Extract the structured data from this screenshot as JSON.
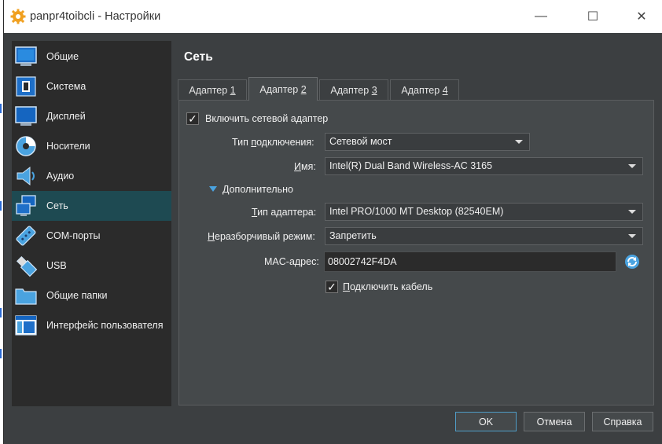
{
  "window": {
    "title": "panpr4toibcli - Настройки",
    "minimize_glyph": "—",
    "maximize_glyph": "☐",
    "close_glyph": "✕"
  },
  "sidebar": {
    "items": [
      {
        "label": "Общие",
        "icon": "general-icon"
      },
      {
        "label": "Система",
        "icon": "chip-icon"
      },
      {
        "label": "Дисплей",
        "icon": "monitor-icon"
      },
      {
        "label": "Носители",
        "icon": "disk-icon"
      },
      {
        "label": "Аудио",
        "icon": "speaker-icon"
      },
      {
        "label": "Сеть",
        "icon": "network-icon",
        "active": true
      },
      {
        "label": "COM-порты",
        "icon": "serial-icon"
      },
      {
        "label": "USB",
        "icon": "usb-icon"
      },
      {
        "label": "Общие папки",
        "icon": "folder-icon"
      },
      {
        "label": "Интерфейс пользователя",
        "icon": "user-interface-icon"
      }
    ]
  },
  "page": {
    "title": "Сеть"
  },
  "tabs": [
    {
      "prefix": "Адаптер ",
      "digit": "1"
    },
    {
      "prefix": "Адаптер ",
      "digit": "2",
      "active": true
    },
    {
      "prefix": "Адаптер ",
      "digit": "3"
    },
    {
      "prefix": "Адаптер ",
      "digit": "4"
    }
  ],
  "adapter": {
    "enable_label": "Включить сетевой адаптер",
    "enable_checked": true,
    "attached_label": "Тип подключения:",
    "attached_value": "Сетевой мост",
    "name_label": "Имя:",
    "name_value": "Intel(R) Dual Band Wireless-AC 3165",
    "advanced_label": "Дополнительно",
    "adapter_type_label": "Тип адаптера:",
    "adapter_type_value": "Intel PRO/1000 MT Desktop (82540EM)",
    "promisc_label": "Неразборчивый режим:",
    "promisc_value": "Запретить",
    "mac_label": "MAC-адрес:",
    "mac_value": "08002742F4DA",
    "cable_label": "Подключить кабель",
    "cable_checked": true,
    "check_glyph": "✓"
  },
  "buttons": {
    "ok": "OK",
    "cancel": "Отмена",
    "help": "Справка"
  },
  "colors": {
    "background": "#3c3f41",
    "sidebar": "#2b2b2b",
    "sidebar_active": "#1e4a52",
    "accent": "#4aa3e0"
  }
}
